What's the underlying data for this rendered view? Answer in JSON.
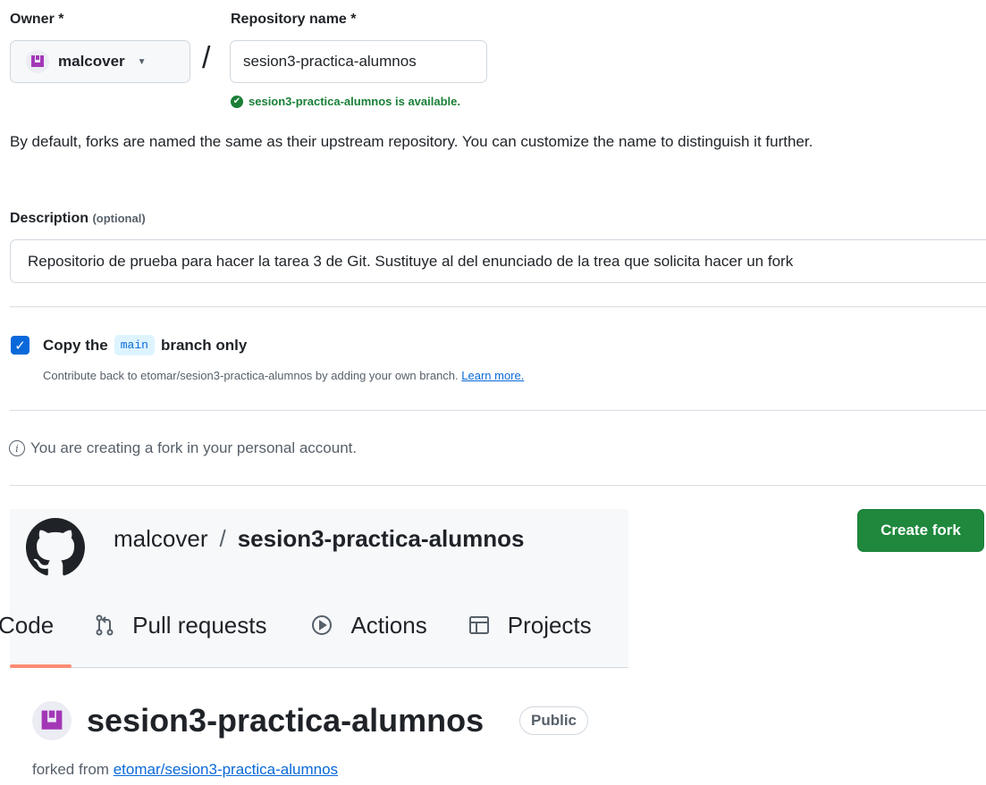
{
  "form": {
    "owner_label": "Owner *",
    "repo_label": "Repository name *",
    "owner_value": "malcover",
    "repo_value": "sesion3-practica-alumnos",
    "available_text": "sesion3-practica-alumnos is available.",
    "hint": "By default, forks are named the same as their upstream repository. You can customize the name to distinguish it further.",
    "description_label": "Description",
    "description_optional": "(optional)",
    "description_value": "Repositorio de prueba para hacer la tarea 3 de Git. Sustituye al del enunciado de la trea que solicita hacer un fork",
    "copy_prefix": "Copy the",
    "copy_branch": "main",
    "copy_suffix": "branch only",
    "copy_checked": true,
    "contribute_text": "Contribute back to etomar/sesion3-practica-alumnos by adding your own branch.",
    "learn_more": "Learn more.",
    "info_text": "You are creating a fork in your personal account.",
    "create_button": "Create fork"
  },
  "header": {
    "owner": "malcover",
    "separator": "/",
    "repo": "sesion3-practica-alumnos",
    "tabs": [
      {
        "label": "Code",
        "icon": "code-icon"
      },
      {
        "label": "Pull requests",
        "icon": "pull-request-icon"
      },
      {
        "label": "Actions",
        "icon": "play-icon"
      },
      {
        "label": "Projects",
        "icon": "table-icon"
      }
    ]
  },
  "repo_card": {
    "title": "sesion3-practica-alumnos",
    "visibility": "Public",
    "forked_prefix": "forked from",
    "forked_link": "etomar/sesion3-practica-alumnos"
  },
  "colors": {
    "accent": "#0969da",
    "success": "#1a7f37",
    "button_green": "#1f883d",
    "avatar": "#a337b6",
    "tab_underline": "#fd8c73"
  }
}
